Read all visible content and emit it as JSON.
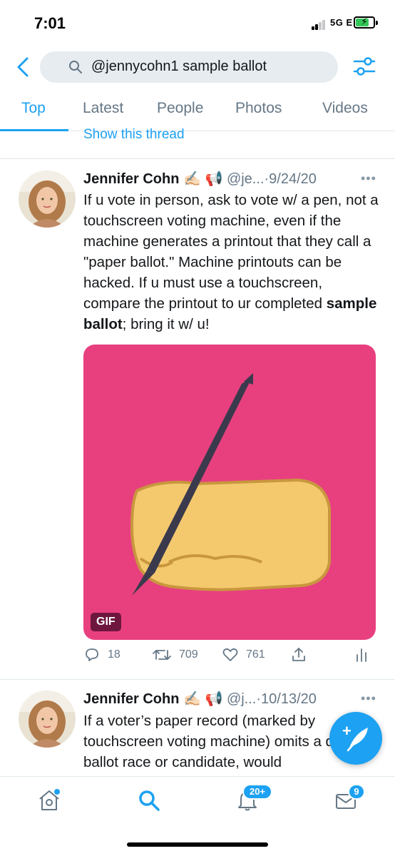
{
  "status_bar": {
    "time": "7:01",
    "network": "5G E"
  },
  "search": {
    "query": "@jennycohn1 sample ballot"
  },
  "tabs": [
    {
      "label": "Top"
    },
    {
      "label": "Latest"
    },
    {
      "label": "People"
    },
    {
      "label": "Photos"
    },
    {
      "label": "Videos"
    }
  ],
  "show_thread": "Show this thread",
  "tweets": [
    {
      "name": "Jennifer Cohn ✍🏻 📢",
      "handle": "@je...",
      "date": "·9/24/20",
      "text_before_bold": "If u vote in person, ask to vote w/ a pen, not a touchscreen voting machine, even if the machine generates a printout that they call a \"paper ballot.\" Machine printouts can be hacked. If u must use a touchscreen, compare the printout to ur completed ",
      "text_bold": "sample ballot",
      "text_after_bold": "; bring it w/ u!",
      "media_badge": "GIF",
      "replies": "18",
      "retweets": "709",
      "likes": "761"
    },
    {
      "name": "Jennifer Cohn ✍🏻 📢",
      "handle": "@j...",
      "date": "·10/13/20",
      "text": "If a voter’s paper record (marked by touchscreen voting machine) omits a down ballot race or candidate, would"
    }
  ],
  "tabbar": {
    "notifications_badge": "20+",
    "messages_badge": "9"
  },
  "colors": {
    "accent": "#1da1f2",
    "gif_background": "#e8407f",
    "text": "#14171a",
    "muted": "#657786"
  }
}
